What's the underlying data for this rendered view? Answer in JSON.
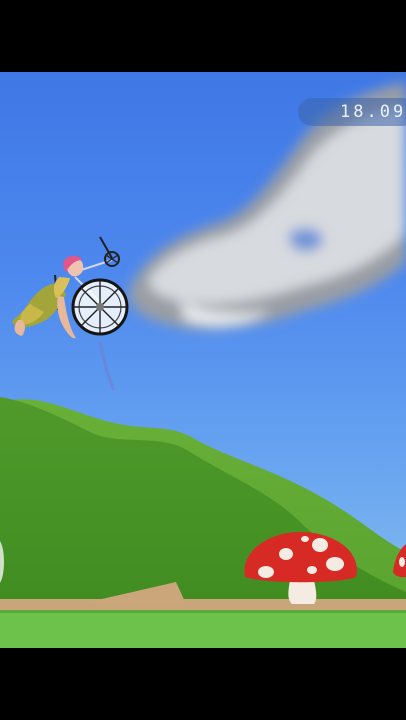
{
  "hud": {
    "timer": "18.09"
  },
  "scene": {
    "sky_color": "#4d88ee",
    "hill_color": "#4f9a2a",
    "ground_color": "#6cc24a",
    "path_color": "#c9a679",
    "mushroom_cap_color": "#d82a24",
    "mushroom_spot_color": "#f4ece2",
    "icons": [
      "wheelchair-icon",
      "character-icon",
      "cloud-icon",
      "mushroom-icon"
    ]
  }
}
